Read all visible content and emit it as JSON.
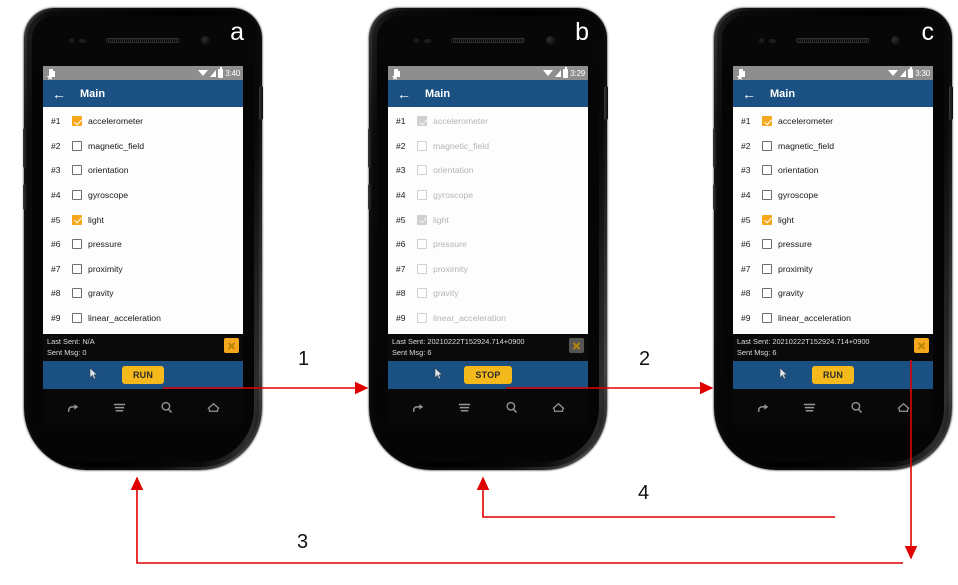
{
  "figure": {
    "panel_labels": [
      "a",
      "b",
      "c"
    ],
    "arrow_labels": [
      "1",
      "2",
      "3",
      "4"
    ],
    "accent_color": "#f5a81c",
    "appbar_color": "#1b5182",
    "arrow_color": "#e00000"
  },
  "phones": [
    {
      "letter": "a",
      "statusbar": {
        "star_icon": "star-icon",
        "sim_icon": "sim-card-icon",
        "wifi_icon": "wifi-icon",
        "signal_icon": "cell-signal-icon",
        "battery_icon": "battery-icon",
        "clock": "3:40"
      },
      "appbar": {
        "back_icon": "back-arrow-icon",
        "title": "Main"
      },
      "list_enabled": true,
      "items": [
        {
          "index": "#1",
          "label": "accelerometer",
          "checked": true
        },
        {
          "index": "#2",
          "label": "magnetic_field",
          "checked": false
        },
        {
          "index": "#3",
          "label": "orientation",
          "checked": false
        },
        {
          "index": "#4",
          "label": "gyroscope",
          "checked": false
        },
        {
          "index": "#5",
          "label": "light",
          "checked": true
        },
        {
          "index": "#6",
          "label": "pressure",
          "checked": false
        },
        {
          "index": "#7",
          "label": "proximity",
          "checked": false
        },
        {
          "index": "#8",
          "label": "gravity",
          "checked": false
        },
        {
          "index": "#9",
          "label": "linear_acceleration",
          "checked": false
        }
      ],
      "status": {
        "last_sent": "Last Sent: N/A",
        "sent_msg": "Sent Msg: 0",
        "close_icon": "close-x-button"
      },
      "action_button": "RUN",
      "nav": [
        "back-icon",
        "menu-icon",
        "search-icon",
        "home-icon"
      ]
    },
    {
      "letter": "b",
      "statusbar": {
        "star_icon": "star-icon",
        "sim_icon": "sim-card-icon",
        "wifi_icon": "wifi-icon",
        "signal_icon": "cell-signal-icon",
        "battery_icon": "battery-icon",
        "clock": "3:29"
      },
      "appbar": {
        "back_icon": "back-arrow-icon",
        "title": "Main"
      },
      "list_enabled": false,
      "items": [
        {
          "index": "#1",
          "label": "accelerometer",
          "checked": true
        },
        {
          "index": "#2",
          "label": "magnetic_field",
          "checked": false
        },
        {
          "index": "#3",
          "label": "orientation",
          "checked": false
        },
        {
          "index": "#4",
          "label": "gyroscope",
          "checked": false
        },
        {
          "index": "#5",
          "label": "light",
          "checked": true
        },
        {
          "index": "#6",
          "label": "pressure",
          "checked": false
        },
        {
          "index": "#7",
          "label": "proximity",
          "checked": false
        },
        {
          "index": "#8",
          "label": "gravity",
          "checked": false
        },
        {
          "index": "#9",
          "label": "linear_acceleration",
          "checked": false
        }
      ],
      "status": {
        "last_sent": "Last Sent: 20210222T152924.714+0900",
        "sent_msg": "Sent Msg: 6",
        "close_icon": "close-x-button"
      },
      "action_button": "STOP",
      "nav": [
        "back-icon",
        "menu-icon",
        "search-icon",
        "home-icon"
      ]
    },
    {
      "letter": "c",
      "statusbar": {
        "star_icon": "star-icon",
        "sim_icon": "sim-card-icon",
        "wifi_icon": "wifi-icon",
        "signal_icon": "cell-signal-icon",
        "battery_icon": "battery-icon",
        "clock": "3:30"
      },
      "appbar": {
        "back_icon": "back-arrow-icon",
        "title": "Main"
      },
      "list_enabled": true,
      "items": [
        {
          "index": "#1",
          "label": "accelerometer",
          "checked": true
        },
        {
          "index": "#2",
          "label": "magnetic_field",
          "checked": false
        },
        {
          "index": "#3",
          "label": "orientation",
          "checked": false
        },
        {
          "index": "#4",
          "label": "gyroscope",
          "checked": false
        },
        {
          "index": "#5",
          "label": "light",
          "checked": true
        },
        {
          "index": "#6",
          "label": "pressure",
          "checked": false
        },
        {
          "index": "#7",
          "label": "proximity",
          "checked": false
        },
        {
          "index": "#8",
          "label": "gravity",
          "checked": false
        },
        {
          "index": "#9",
          "label": "linear_acceleration",
          "checked": false
        }
      ],
      "status": {
        "last_sent": "Last Sent: 20210222T152924.714+0900",
        "sent_msg": "Sent Msg: 6",
        "close_icon": "close-x-button"
      },
      "action_button": "RUN",
      "nav": [
        "back-icon",
        "menu-icon",
        "search-icon",
        "home-icon"
      ]
    }
  ]
}
